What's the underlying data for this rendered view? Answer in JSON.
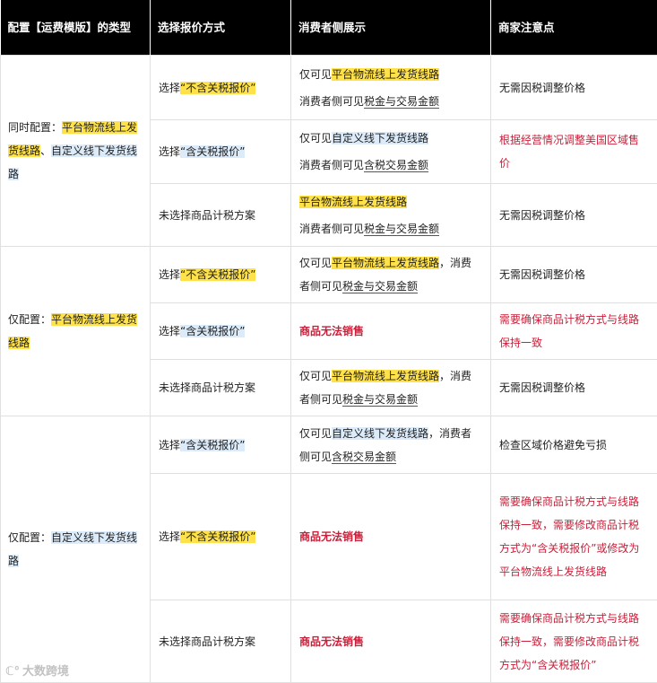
{
  "headers": [
    "配置【运费模版】的类型",
    "选择报价方式",
    "消费者侧展示",
    "商家注意点"
  ],
  "groups": [
    {
      "label_prefix": "同时配置：",
      "label_yellow": "平台物流线上发货线路",
      "label_sep": "、",
      "label_blue": "自定义线下发货线路",
      "rows": [
        {
          "method_prefix": "选择",
          "method_quote": "“不含关税报价”",
          "display_line1_prefix": "仅可见",
          "display_line1_hl": "平台物流线上发货线路",
          "display_line2_prefix": "消费者侧可见",
          "display_line2_ul": "税金与交易金额",
          "note": "无需因税调整价格"
        },
        {
          "method_prefix": "选择",
          "method_quote": "“含关税报价”",
          "display_line1_prefix": "仅可见",
          "display_line1_hl": "自定义线下发货线路",
          "display_line2_prefix": "消费者侧可见",
          "display_line2_ul": "含税交易金额",
          "note": "根据经营情况调整美国区域售价"
        },
        {
          "method_text": "未选择商品计税方案",
          "display_line1_hl": "平台物流线上发货线路",
          "display_line2_prefix": "消费者侧可见",
          "display_line2_ul": "税金与交易金额",
          "note": "无需因税调整价格"
        }
      ]
    },
    {
      "label_prefix": "仅配置：",
      "label_yellow": "平台物流线上发货线路",
      "rows": [
        {
          "method_prefix": "选择",
          "method_quote": "“不含关税报价”",
          "display_prefix": "仅可见",
          "display_hl": "平台物流线上发货线路",
          "display_mid": "，消费者侧可见",
          "display_ul": "税金与交易金额",
          "note": "无需因税调整价格"
        },
        {
          "method_prefix": "选择",
          "method_quote": "“含关税报价”",
          "display_bold": "商品无法销售",
          "note": "需要确保商品计税方式与线路保持一致"
        },
        {
          "method_text": "未选择商品计税方案",
          "display_prefix": "仅可见",
          "display_hl": "平台物流线上发货线路",
          "display_mid": "，消费者侧可见",
          "display_ul": "税金与交易金额",
          "note": "无需因税调整价格"
        }
      ]
    },
    {
      "label_prefix": "仅配置：",
      "label_blue": "自定义线下发货线路",
      "rows": [
        {
          "method_prefix": "选择",
          "method_quote": "“含关税报价”",
          "display_prefix": "仅可见",
          "display_hl": "自定义线下发货线路",
          "display_mid": "，消费者侧可见",
          "display_ul": "含税交易金额",
          "note": "检查区域价格避免亏损"
        },
        {
          "method_prefix": "选择",
          "method_quote": "“不含关税报价”",
          "display_bold": "商品无法销售",
          "note": "需要确保商品计税方式与线路保持一致，需要修改商品计税方式为“含关税报价”或修改为平台物流线上发货线路"
        },
        {
          "method_text": "未选择商品计税方案",
          "display_bold": "商品无法销售",
          "note": "需要确保商品计税方式与线路保持一致，需要修改商品计税方式为“含关税报价”"
        }
      ]
    }
  ],
  "watermark": "大数跨境",
  "watermark_icon": "logo-icon"
}
